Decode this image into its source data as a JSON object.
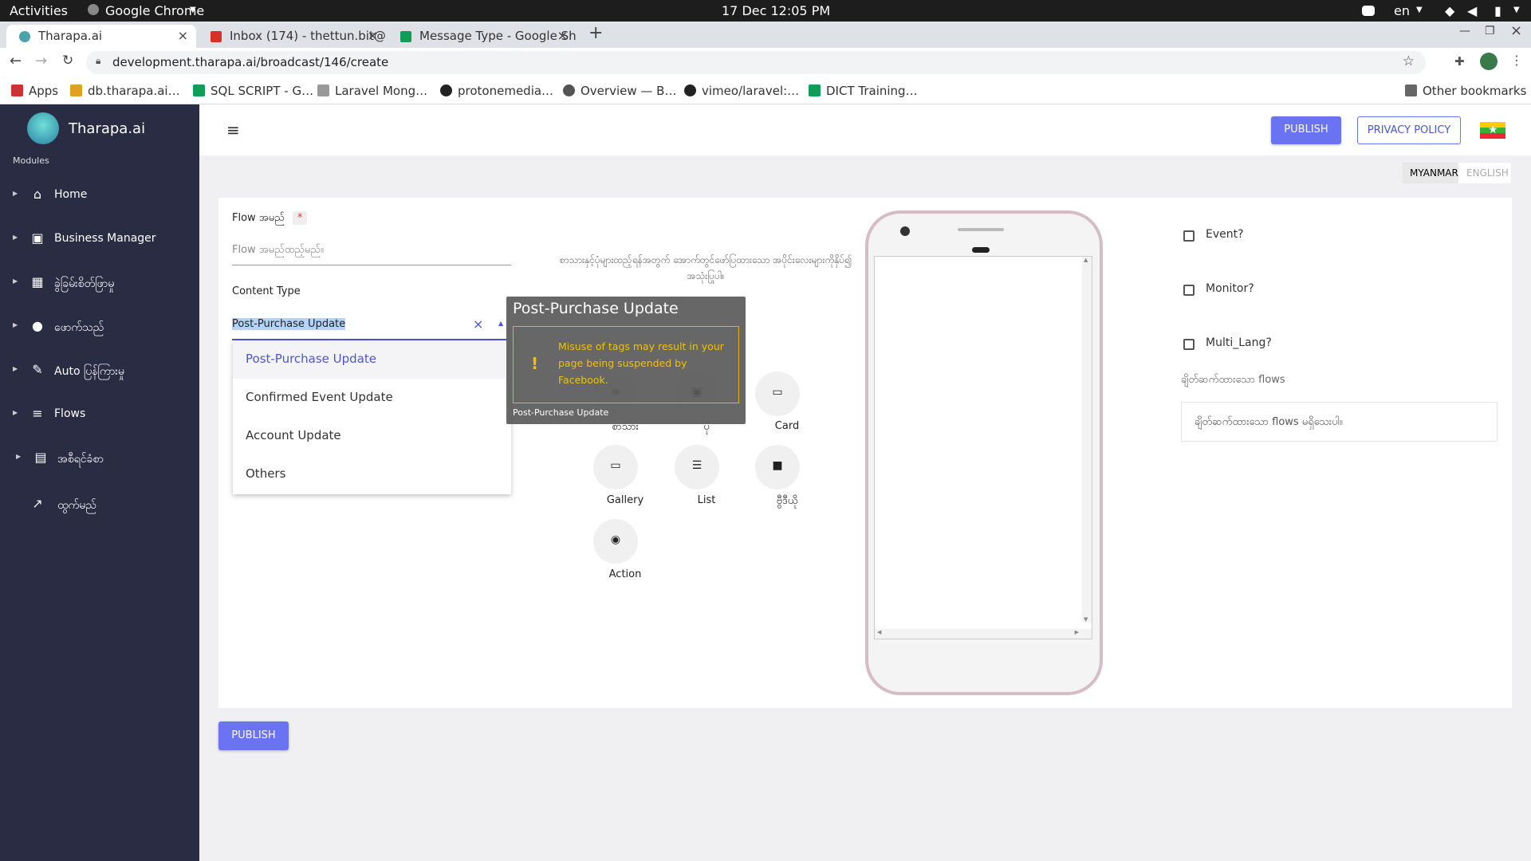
{
  "os": {
    "activities": "Activities",
    "app_name": "Google Chrome",
    "clock": "17 Dec  12:05 PM",
    "lang": "en"
  },
  "browser": {
    "tabs": [
      {
        "title": "Tharapa.ai"
      },
      {
        "title": "Inbox (174) - thettun.bit@"
      },
      {
        "title": "Message Type - Google Sh"
      }
    ],
    "url": "development.tharapa.ai/broadcast/146/create",
    "bookmarks": [
      "Apps",
      "db.tharapa.ai…",
      "SQL SCRIPT - G…",
      "Laravel Mong…",
      "protonemedia…",
      "Overview — B…",
      "vimeo/laravel:…",
      "DICT Training…"
    ],
    "other_bookmarks": "Other bookmarks"
  },
  "sidebar": {
    "brand": "Tharapa.ai",
    "section": "Modules",
    "items": [
      {
        "label": "Home",
        "icon": "home-icon"
      },
      {
        "label": "Business Manager",
        "icon": "briefcase-icon"
      },
      {
        "label": "ခွဲခြမ်းစိတ်ဖြာမှု",
        "icon": "dashboard-icon"
      },
      {
        "label": "ဖောက်သည်",
        "icon": "person-icon"
      },
      {
        "label": "Auto ပြန်ကြားမှု",
        "icon": "wrench-icon"
      },
      {
        "label": "Flows",
        "icon": "filter-icon"
      },
      {
        "label": "အစီရင်ခံစာ",
        "icon": "document-icon"
      },
      {
        "label": "ထွက်မည်",
        "icon": "external-link-icon"
      }
    ]
  },
  "header": {
    "publish": "PUBLISH",
    "privacy": "PRIVACY POLICY"
  },
  "lang_toggle": {
    "myanmar": "MYANMAR",
    "english": "ENGLISH"
  },
  "form": {
    "flow_name_label": "Flow အမည်",
    "required_mark": "*",
    "flow_name_placeholder": "Flow အမည်ထည့်မည်။",
    "content_type_label": "Content Type",
    "content_type_value": "Post-Purchase Update",
    "content_type_options": [
      "Post-Purchase Update",
      "Confirmed Event Update",
      "Account Update",
      "Others"
    ],
    "hint": "စာသားနှင့်ပုံများထည့်ရန်အတွက် အောက်တွင်ဖော်ပြထားသော အပိုင်းလေးများကိုနှိပ်၍ အသုံးပြုပါ။"
  },
  "tooltip": {
    "title": "Post-Purchase Update",
    "warning": "Misuse of tags may result in your page being suspended by Facebook.",
    "footer": "Post-Purchase Update"
  },
  "blocks": [
    {
      "label": "စာသား",
      "icon": "text-icon"
    },
    {
      "label": "ပုံ",
      "icon": "image-icon"
    },
    {
      "label": "Card",
      "icon": "card-icon"
    },
    {
      "label": "Gallery",
      "icon": "gallery-icon"
    },
    {
      "label": "List",
      "icon": "list-icon"
    },
    {
      "label": "ဗွီဒီယို",
      "icon": "video-icon"
    },
    {
      "label": "Action",
      "icon": "radio-icon"
    }
  ],
  "options": {
    "event": "Event?",
    "monitor": "Monitor?",
    "multi_lang": "Multi_Lang?",
    "linked_flows_label": "ချိတ်ဆက်ထားသော flows",
    "linked_flows_empty": "ချိတ်ဆက်ထားသော flows မရှိသေးပါ။"
  },
  "footer": {
    "publish": "PUBLISH"
  }
}
